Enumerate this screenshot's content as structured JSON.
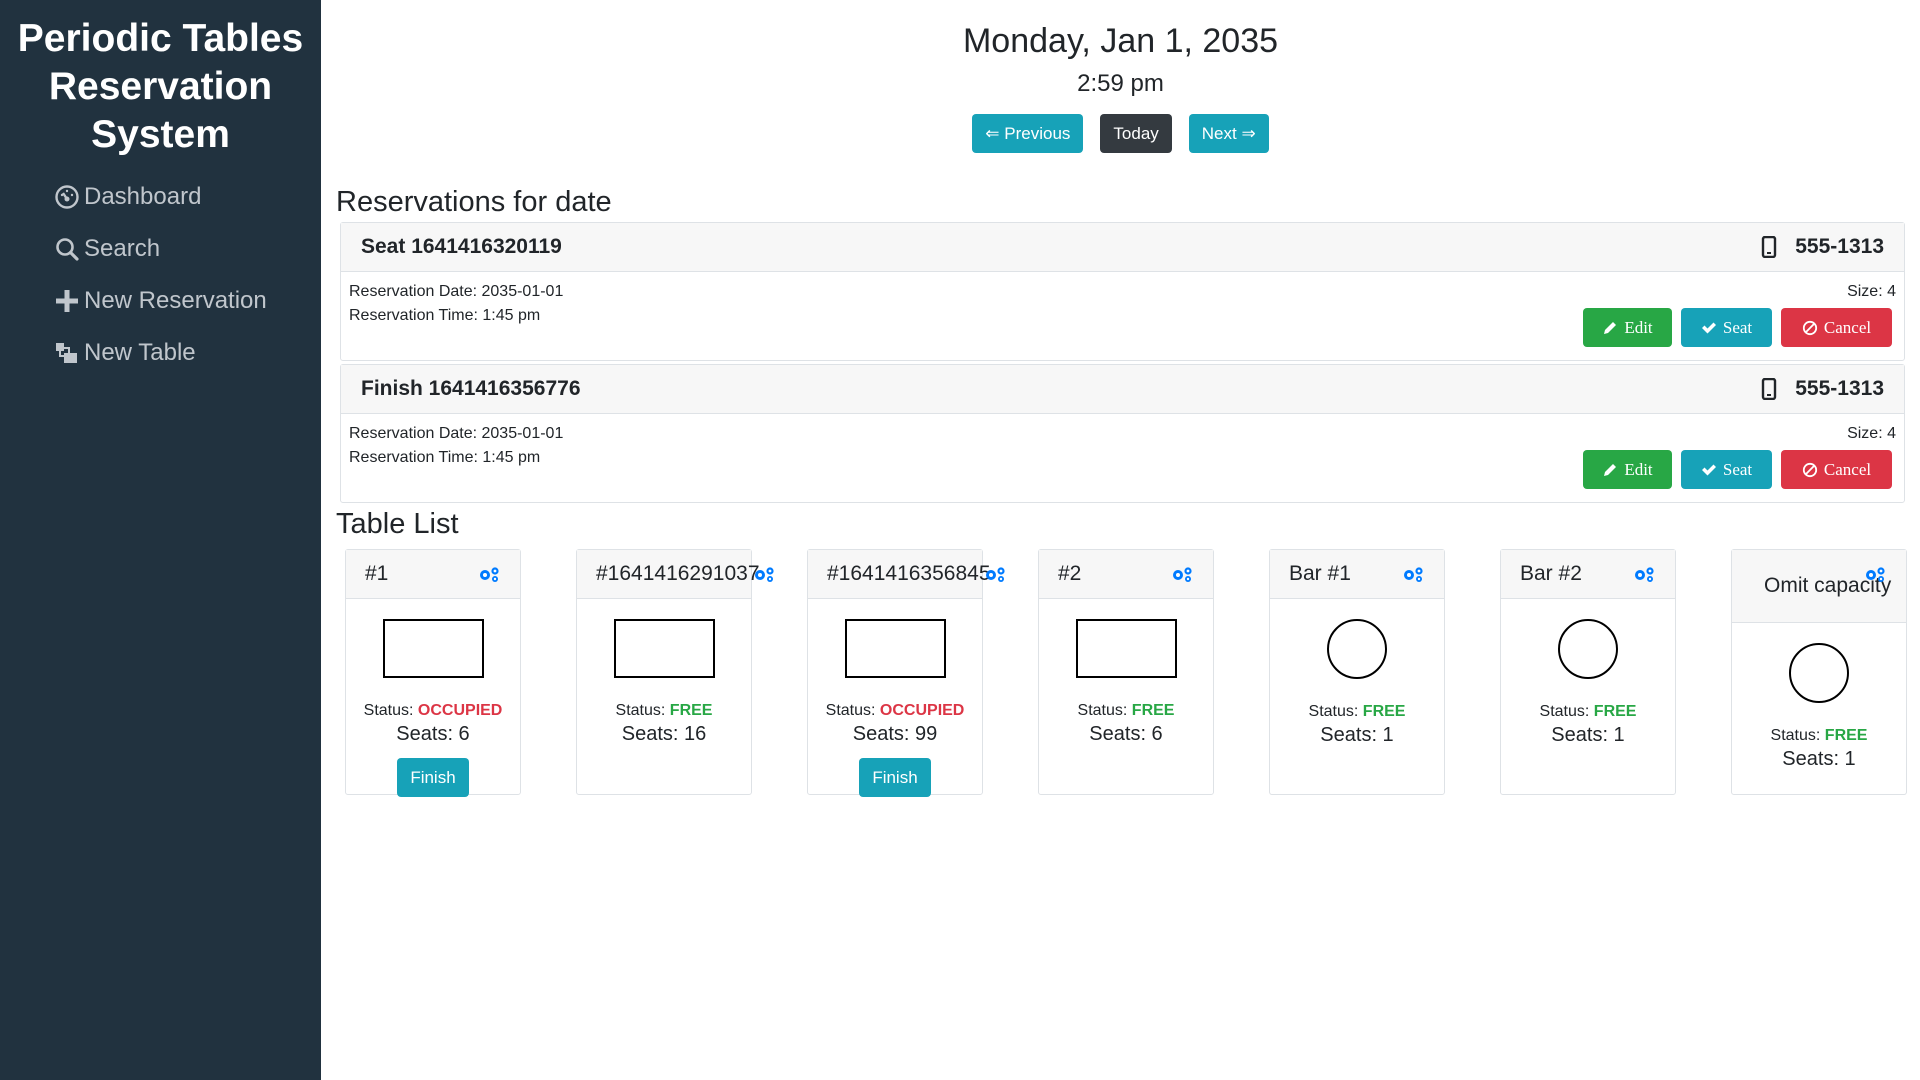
{
  "sidebar": {
    "brand": "Periodic Tables Reservation System",
    "items": [
      {
        "label": "Dashboard",
        "icon": "dashboard-gauge-icon"
      },
      {
        "label": "Search",
        "icon": "search-icon"
      },
      {
        "label": "New Reservation",
        "icon": "plus-icon"
      },
      {
        "label": "New Table",
        "icon": "layers-icon"
      }
    ]
  },
  "header": {
    "date": "Monday, Jan 1, 2035",
    "time": "2:59 pm",
    "previous_label": "⇐ Previous",
    "today_label": "Today",
    "next_label": "Next ⇒"
  },
  "reservations": {
    "title": "Reservations for date",
    "items": [
      {
        "name": "Seat 1641416320119",
        "phone": "555-1313",
        "date_line": "Reservation Date: 2035-01-01",
        "time_line": "Reservation Time: 1:45 pm",
        "size_line": "Size: 4",
        "edit_label": "Edit",
        "seat_label": "Seat",
        "cancel_label": "Cancel"
      },
      {
        "name": "Finish 1641416356776",
        "phone": "555-1313",
        "date_line": "Reservation Date: 2035-01-01",
        "time_line": "Reservation Time: 1:45 pm",
        "size_line": "Size: 4",
        "edit_label": "Edit",
        "seat_label": "Seat",
        "cancel_label": "Cancel"
      }
    ]
  },
  "tables": {
    "title": "Table List",
    "status_prefix": "Status:",
    "finish_label": "Finish",
    "items": [
      {
        "name": "#1",
        "shape": "rect",
        "status": "OCCUPIED",
        "seats": "Seats: 6"
      },
      {
        "name": "#1641416291037",
        "shape": "rect",
        "status": "FREE",
        "seats": "Seats: 16"
      },
      {
        "name": "#1641416356845",
        "shape": "rect",
        "status": "OCCUPIED",
        "seats": "Seats: 99"
      },
      {
        "name": "#2",
        "shape": "rect",
        "status": "FREE",
        "seats": "Seats: 6"
      },
      {
        "name": "Bar #1",
        "shape": "circle",
        "status": "FREE",
        "seats": "Seats: 1"
      },
      {
        "name": "Bar #2",
        "shape": "circle",
        "status": "FREE",
        "seats": "Seats: 1"
      },
      {
        "name": "Omit capacity",
        "shape": "circle",
        "status": "FREE",
        "seats": "Seats: 1"
      }
    ]
  },
  "colors": {
    "sidebar_bg": "#21323f",
    "info": "#17a2b8",
    "success": "#28a745",
    "danger": "#dc3545",
    "dark": "#343a40",
    "gear": "#007bff"
  }
}
